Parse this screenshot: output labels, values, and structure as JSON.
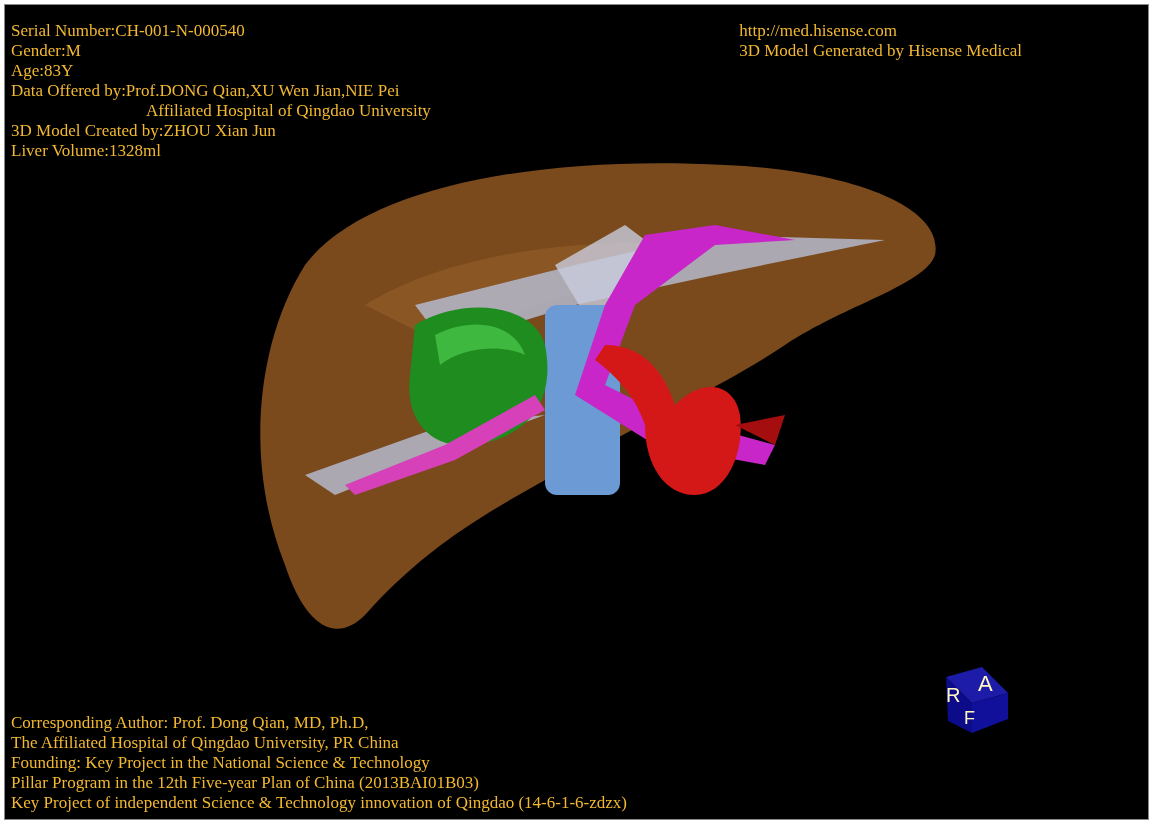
{
  "info_left": [
    {
      "text": "Serial Number:CH-001-N-000540",
      "indented": false
    },
    {
      "text": "Gender:M",
      "indented": false
    },
    {
      "text": "Age:83Y",
      "indented": false
    },
    {
      "text": "Data Offered by:Prof.DONG Qian,XU Wen Jian,NIE Pei",
      "indented": false
    },
    {
      "text": "Affiliated Hospital of Qingdao University",
      "indented": true
    },
    {
      "text": "3D Model Created by:ZHOU Xian Jun",
      "indented": false
    },
    {
      "text": "Liver Volume:1328ml",
      "indented": false
    }
  ],
  "info_right": [
    "http://med.hisense.com",
    "3D Model Generated by Hisense Medical"
  ],
  "footer": [
    "Corresponding Author: Prof. Dong Qian, MD, Ph.D,",
    "The Affiliated Hospital of Qingdao University, PR China",
    "Founding: Key Project in the National Science & Technology",
    "Pillar Program in the 12th Five-year Plan of China (2013BAI01B03)",
    "Key Project of independent Science & Technology innovation of Qingdao (14-6-1-6-zdzx)"
  ],
  "orientation_cube": {
    "labels": [
      "R",
      "A",
      "F"
    ]
  }
}
